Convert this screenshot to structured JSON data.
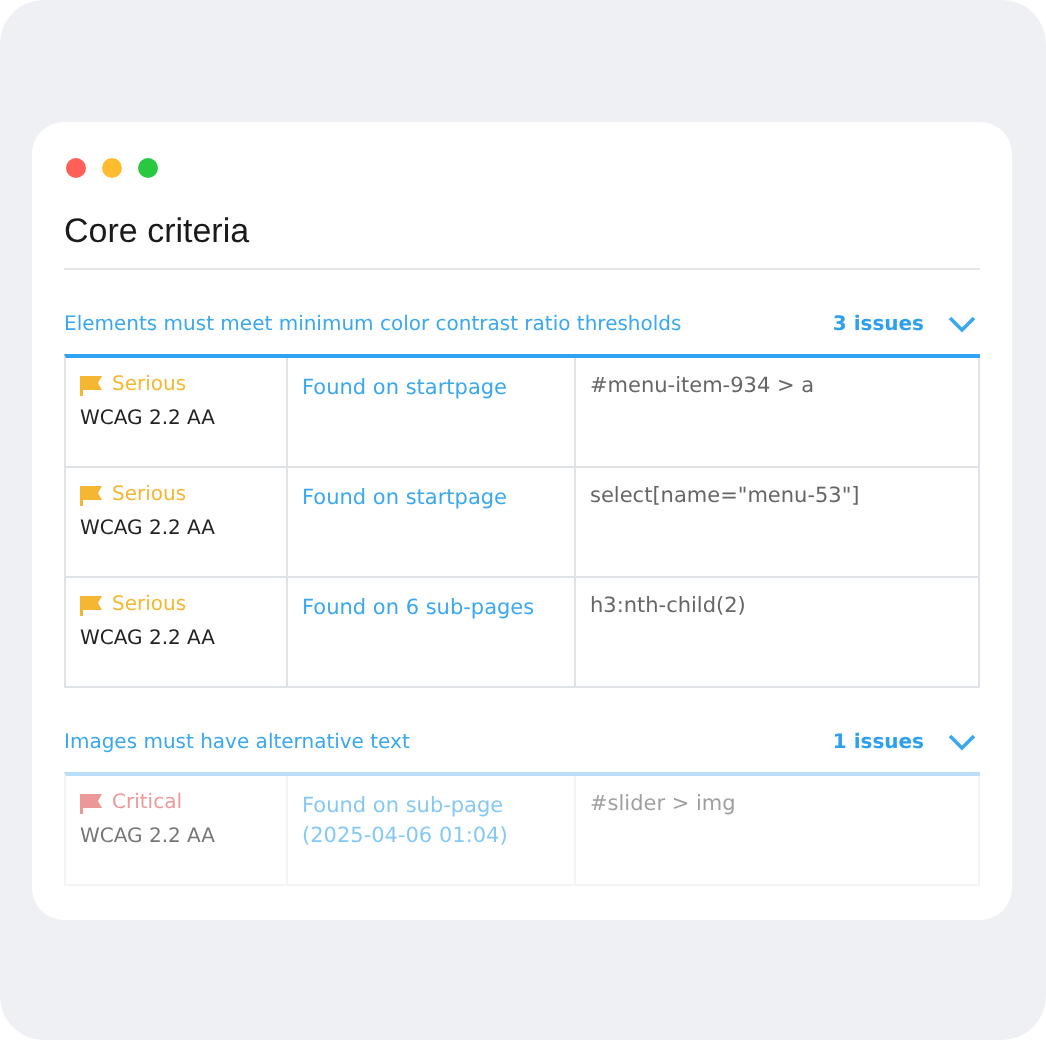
{
  "window": {
    "controls": [
      {
        "kind": "close"
      },
      {
        "kind": "minimize"
      },
      {
        "kind": "maximize"
      }
    ]
  },
  "title": "Core criteria",
  "sections": [
    {
      "heading": "Elements must meet minimum color contrast ratio thresholds",
      "count": "3 issues",
      "expanded": true,
      "faded": false,
      "rows": [
        {
          "severity": "Serious",
          "kind": "serious",
          "standard": "WCAG 2.2 AA",
          "found": "Found on startpage",
          "selector": "#menu-item-934 > a"
        },
        {
          "severity": "Serious",
          "kind": "serious",
          "standard": "WCAG 2.2 AA",
          "found": "Found on startpage",
          "selector": "select[name=\"menu-53\"]"
        },
        {
          "severity": "Serious",
          "kind": "serious",
          "standard": "WCAG 2.2 AA",
          "found": "Found on 6 sub-pages",
          "selector": "h3:nth-child(2)"
        }
      ]
    },
    {
      "heading": "Images must have alternative text",
      "count": "1 issues",
      "expanded": true,
      "faded": true,
      "rows": [
        {
          "severity": "Critical",
          "kind": "critical",
          "standard": "WCAG 2.2 AA",
          "found": "Found on sub-page",
          "date": "(2025-04-06 01:04)",
          "selector": "#slider > img"
        }
      ]
    }
  ]
}
